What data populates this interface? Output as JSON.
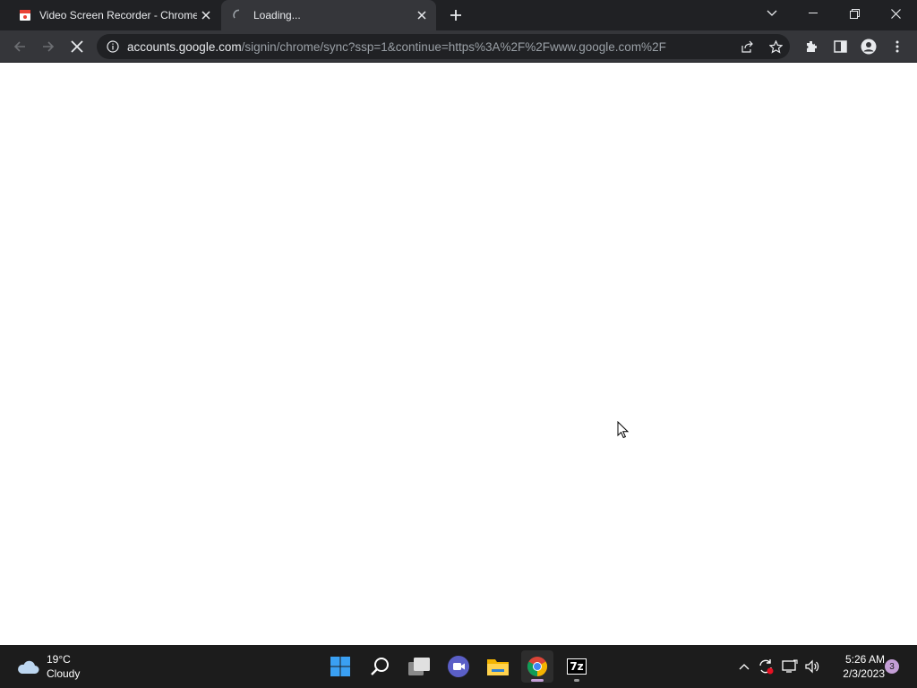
{
  "browser": {
    "tabs": [
      {
        "title": "Video Screen Recorder - Chrome",
        "favicon": "recorder-favicon"
      },
      {
        "title": "Loading...",
        "favicon": "loading-spinner-icon"
      }
    ],
    "address": {
      "host": "accounts.google.com",
      "path": "/signin/chrome/sync?ssp=1&continue=https%3A%2F%2Fwww.google.com%2F"
    }
  },
  "taskbar": {
    "weather": {
      "temp": "19°C",
      "condition": "Cloudy"
    },
    "clock": {
      "time": "5:26 AM",
      "date": "2/3/2023"
    },
    "notifications": "3",
    "apps": [
      "start",
      "search",
      "task-view",
      "meet",
      "file-explorer",
      "chrome",
      "7zip"
    ],
    "seven_zip_label": "7z"
  },
  "colors": {
    "titlebar": "#202124",
    "toolbar": "#35363a",
    "taskbar": "#1c1c1c",
    "accent": "#8ab4f8"
  }
}
